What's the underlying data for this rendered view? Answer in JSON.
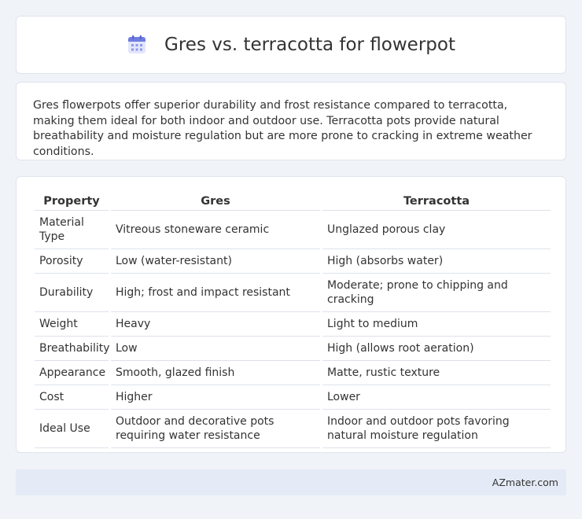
{
  "header": {
    "title": "Gres vs. terracotta for flowerpot",
    "icon": "calendar-icon"
  },
  "summary": {
    "text": "Gres flowerpots offer superior durability and frost resistance compared to terracotta, making them ideal for both indoor and outdoor use. Terracotta pots provide natural breathability and moisture regulation but are more prone to cracking in extreme weather conditions."
  },
  "table": {
    "headers": [
      "Property",
      "Gres",
      "Terracotta"
    ],
    "rows": [
      [
        "Material Type",
        "Vitreous stoneware ceramic",
        "Unglazed porous clay"
      ],
      [
        "Porosity",
        "Low (water-resistant)",
        "High (absorbs water)"
      ],
      [
        "Durability",
        "High; frost and impact resistant",
        "Moderate; prone to chipping and cracking"
      ],
      [
        "Weight",
        "Heavy",
        "Light to medium"
      ],
      [
        "Breathability",
        "Low",
        "High (allows root aeration)"
      ],
      [
        "Appearance",
        "Smooth, glazed finish",
        "Matte, rustic texture"
      ],
      [
        "Cost",
        "Higher",
        "Lower"
      ],
      [
        "Ideal Use",
        "Outdoor and decorative pots requiring water resistance",
        "Indoor and outdoor pots favoring natural moisture regulation"
      ]
    ]
  },
  "footer": {
    "text": "AZmater.com"
  }
}
